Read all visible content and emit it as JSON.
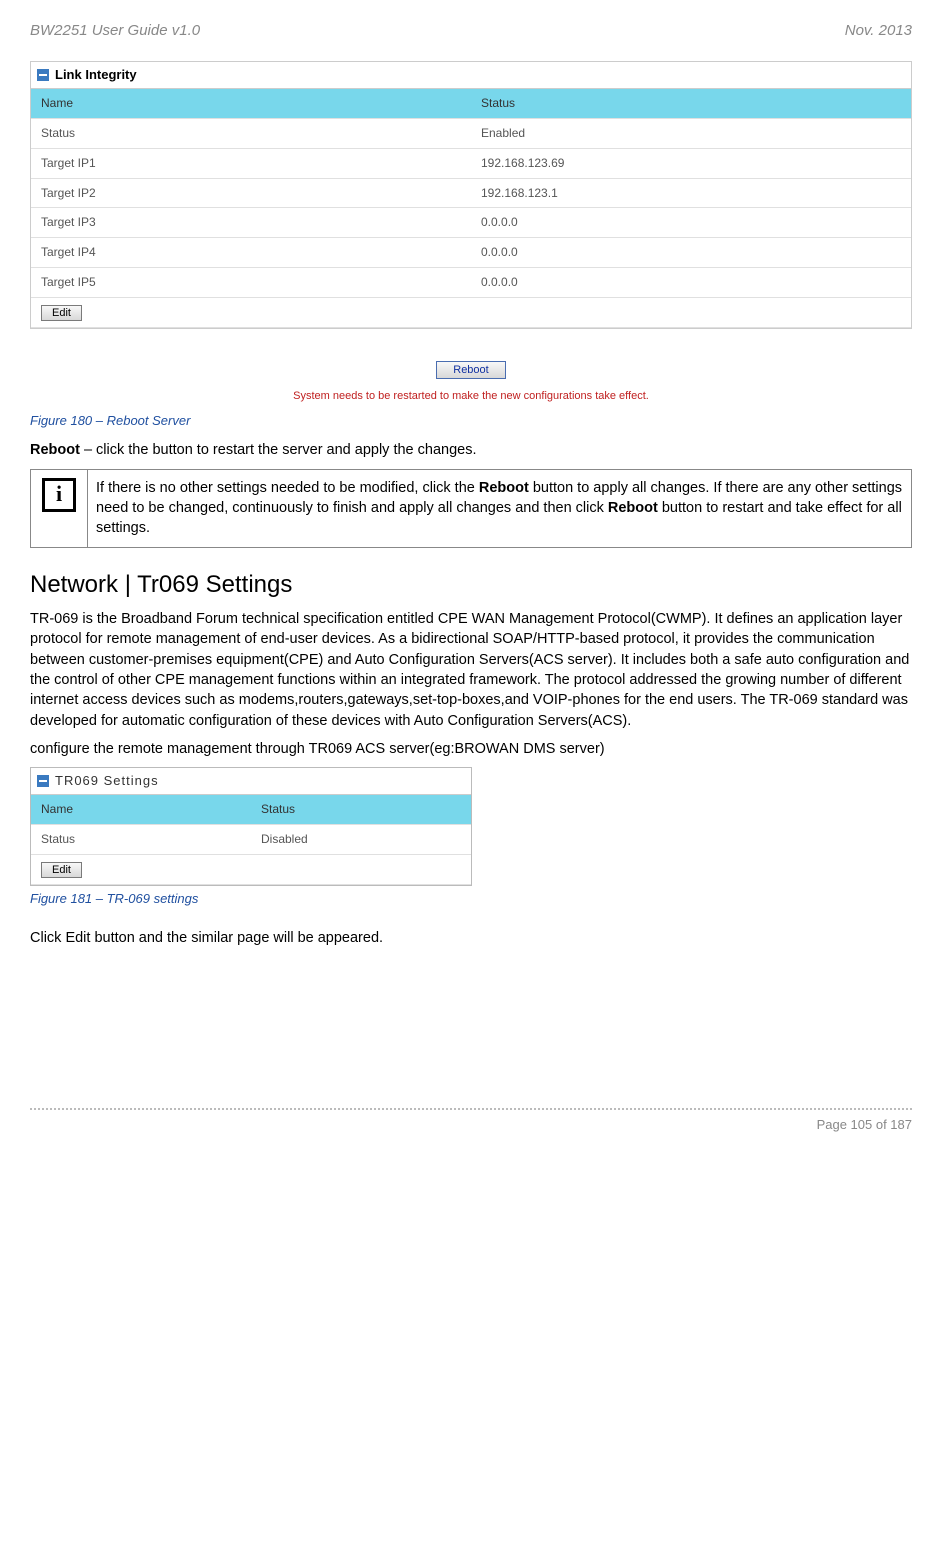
{
  "header": {
    "left": "BW2251 User Guide v1.0",
    "right": "Nov.  2013"
  },
  "link_integrity": {
    "title": "Link Integrity",
    "columns": [
      "Name",
      "Status"
    ],
    "rows": [
      [
        "Status",
        "Enabled"
      ],
      [
        "Target IP1",
        "192.168.123.69"
      ],
      [
        "Target IP2",
        "192.168.123.1"
      ],
      [
        "Target IP3",
        "0.0.0.0"
      ],
      [
        "Target IP4",
        "0.0.0.0"
      ],
      [
        "Target IP5",
        "0.0.0.0"
      ]
    ],
    "edit_label": "Edit"
  },
  "reboot": {
    "button": "Reboot",
    "message": "System needs to be restarted to make the new configurations take effect."
  },
  "fig180": "Figure 180 – Reboot Server",
  "reboot_line_prefix": "Reboot",
  "reboot_line_rest": " – click the button to restart the server and apply the changes.",
  "note": {
    "p1a": "If there is no other settings needed to be modified, click the ",
    "p1b": "Reboot",
    "p1c": " button to apply all changes. If there are any other settings need to be changed, continuously to finish and apply all changes and then click ",
    "p1d": "Reboot",
    "p1e": " button to restart and take effect  for all settings."
  },
  "section_title": "Network | Tr069 Settings",
  "tr069_para": "TR-069 is the Broadband Forum technical specification entitled CPE WAN Management Protocol(CWMP). It defines an application layer protocol for remote management of end-user devices. As a bidirectional SOAP/HTTP-based protocol, it provides the communication between customer-premises equipment(CPE) and Auto Configuration Servers(ACS server). It includes both a safe auto configuration and the control of other CPE management functions within an integrated framework. The protocol addressed the growing number of different internet access devices such as modems,routers,gateways,set-top-boxes,and VOIP-phones for the end users. The TR-069 standard was developed for automatic configuration of these devices with Auto Configuration Servers(ACS).",
  "tr069_config_line": "configure the remote management through TR069 ACS server(eg:BROWAN DMS server)",
  "tr069_panel": {
    "title": "TR069 Settings",
    "columns": [
      "Name",
      "Status"
    ],
    "rows": [
      [
        "Status",
        "Disabled"
      ]
    ],
    "edit_label": "Edit"
  },
  "fig181": "Figure 181 – TR-069 settings",
  "click_edit_line": "Click Edit button and the similar page will be appeared.",
  "footer": "Page 105 of 187"
}
